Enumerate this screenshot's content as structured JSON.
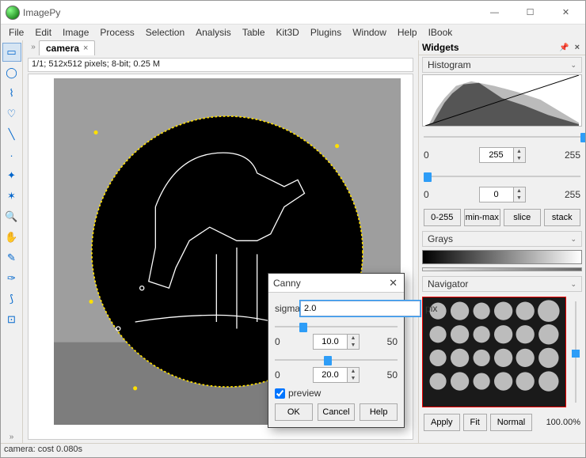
{
  "window": {
    "title": "ImagePy"
  },
  "menu": [
    "File",
    "Edit",
    "Image",
    "Process",
    "Selection",
    "Analysis",
    "Table",
    "Kit3D",
    "Plugins",
    "Window",
    "Help",
    "IBook"
  ],
  "tools": [
    {
      "name": "rect-select-icon",
      "glyph": "▭",
      "selected": true
    },
    {
      "name": "oval-select-icon",
      "glyph": "◯"
    },
    {
      "name": "polyline-icon",
      "glyph": "⌇"
    },
    {
      "name": "freehand-icon",
      "glyph": "♡"
    },
    {
      "name": "line-icon",
      "glyph": "╲"
    },
    {
      "name": "point-icon",
      "glyph": "·"
    },
    {
      "name": "marker-icon",
      "glyph": "✦"
    },
    {
      "name": "wand-icon",
      "glyph": "✶"
    },
    {
      "name": "zoom-icon",
      "glyph": "🔍"
    },
    {
      "name": "hand-icon",
      "glyph": "✋"
    },
    {
      "name": "pencil-icon",
      "glyph": "✎"
    },
    {
      "name": "dropper-icon",
      "glyph": "✑"
    },
    {
      "name": "bucket-icon",
      "glyph": "⟆"
    },
    {
      "name": "crop-icon",
      "glyph": "⊡"
    }
  ],
  "tab": {
    "name": "camera",
    "close": "×"
  },
  "info": "1/1;   512x512 pixels; 8-bit; 0.25 M",
  "widgets": {
    "header": "Widgets"
  },
  "histogram": {
    "header": "Histogram",
    "axis_min": "0",
    "axis_max": "255",
    "high": {
      "value": "255",
      "thumb_pct": 100
    },
    "low": {
      "value": "0",
      "thumb_pct": 0
    },
    "buttons": [
      "0-255",
      "min-max",
      "slice",
      "stack"
    ],
    "colormap_label": "Grays"
  },
  "navigator": {
    "header": "Navigator",
    "buttons": [
      "Apply",
      "Fit",
      "Normal"
    ],
    "zoom": "100.00%"
  },
  "dialog": {
    "title": "Canny",
    "sigma": {
      "label": "sigma",
      "value": "2.0",
      "unit": "pix"
    },
    "p1": {
      "min": "0",
      "max": "50",
      "value": "10.0",
      "thumb_pct": 20
    },
    "p2": {
      "min": "0",
      "max": "50",
      "value": "20.0",
      "thumb_pct": 40
    },
    "preview": {
      "label": "preview",
      "checked": true
    },
    "buttons": {
      "ok": "OK",
      "cancel": "Cancel",
      "help": "Help"
    }
  },
  "status": "camera: cost 0.080s"
}
